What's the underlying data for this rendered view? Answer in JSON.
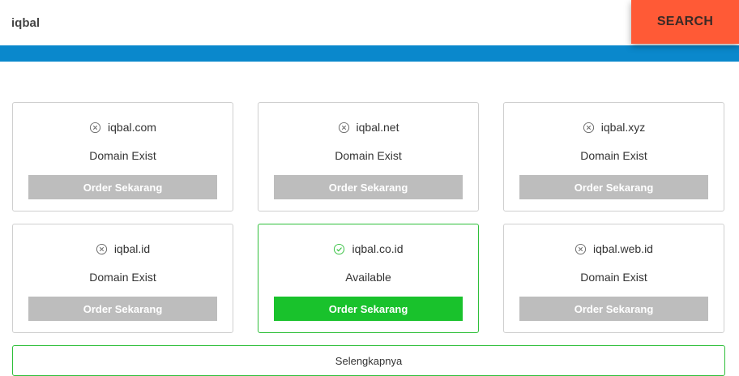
{
  "search": {
    "value": "iqbal",
    "button_label": "SEARCH"
  },
  "colors": {
    "search_button": "#ff5a36",
    "strip": "#0a88cc",
    "available": "#19c22c",
    "disabled": "#bdbdbd"
  },
  "results": [
    {
      "domain": "iqbal.com",
      "status": "Domain Exist",
      "icon": "x-circle-icon",
      "action": "Order Sekarang"
    },
    {
      "domain": "iqbal.net",
      "status": "Domain Exist",
      "icon": "x-circle-icon",
      "action": "Order Sekarang"
    },
    {
      "domain": "iqbal.xyz",
      "status": "Domain Exist",
      "icon": "x-circle-icon",
      "action": "Order Sekarang"
    },
    {
      "domain": "iqbal.id",
      "status": "Domain Exist",
      "icon": "x-circle-icon",
      "action": "Order Sekarang"
    },
    {
      "domain": "iqbal.co.id",
      "status": "Available",
      "icon": "check-circle-icon",
      "action": "Order Sekarang"
    },
    {
      "domain": "iqbal.web.id",
      "status": "Domain Exist",
      "icon": "x-circle-icon",
      "action": "Order Sekarang"
    }
  ],
  "more_label": "Selengkapnya"
}
